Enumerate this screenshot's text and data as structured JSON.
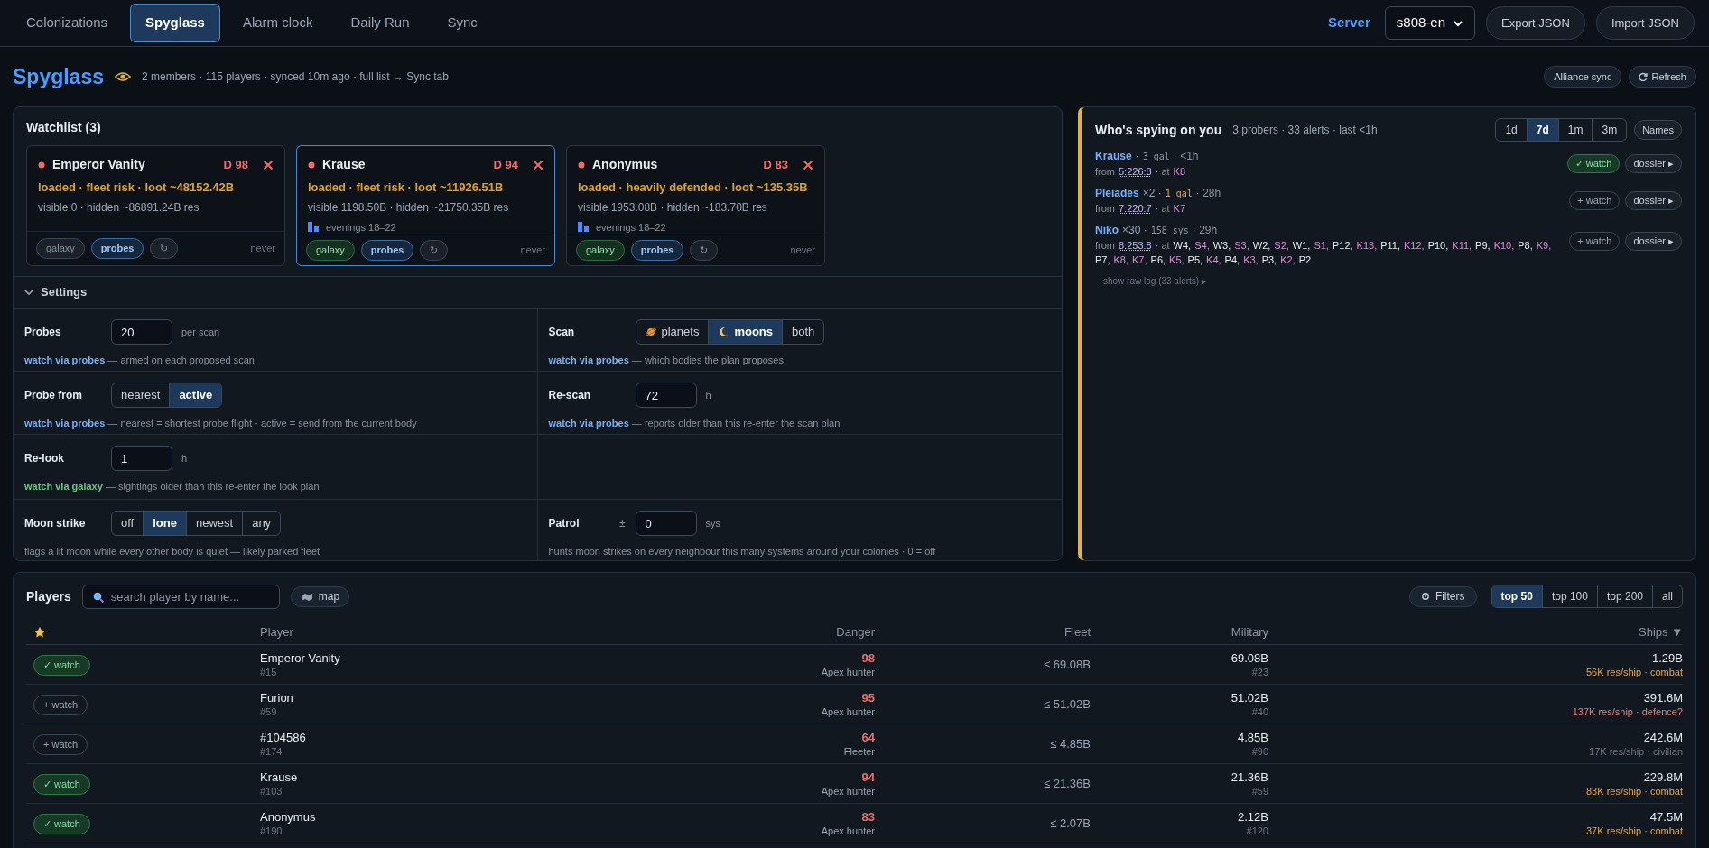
{
  "nav": {
    "tabs": [
      {
        "label": "Colonizations",
        "selected": false
      },
      {
        "label": "Spyglass",
        "selected": true
      },
      {
        "label": "Alarm clock",
        "selected": false
      },
      {
        "label": "Daily Run",
        "selected": false
      },
      {
        "label": "Sync",
        "selected": false
      }
    ],
    "server_label": "Server",
    "server_value": "s808-en",
    "buttons": [
      "Export JSON",
      "Import JSON"
    ]
  },
  "header": {
    "title": "Spyglass",
    "subtitle": "2 members · 115 players · synced 10m ago · full list → Sync tab",
    "buttons": [
      {
        "label": "Alliance sync",
        "kind": "plain"
      },
      {
        "label": "Refresh",
        "kind": "refresh"
      }
    ]
  },
  "watchlist": {
    "title": "Watchlist (3)",
    "cards": [
      {
        "name": "Emperor Vanity",
        "selected": false,
        "danger": "D 98",
        "status": "loaded · fleet risk · loot ~48152.42B",
        "resources": "visible 0 · hidden ~86891.24B res",
        "tags": [
          {
            "label": "galaxy",
            "kind": "galaxy",
            "on": false
          },
          {
            "label": "probes",
            "kind": "probes",
            "on": true
          }
        ],
        "refresh": "↻",
        "last": "never"
      },
      {
        "name": "Krause",
        "selected": true,
        "danger": "D 94",
        "status": "loaded · fleet risk · loot ~11926.51B",
        "resources": "visible 1198.50B · hidden ~21750.35B res",
        "activity": "evenings 18–22",
        "tags": [
          {
            "label": "galaxy",
            "kind": "galaxy",
            "on": true
          },
          {
            "label": "probes",
            "kind": "probes",
            "on": true
          }
        ],
        "refresh": "↻",
        "last": "never"
      },
      {
        "name": "Anonymus",
        "selected": false,
        "danger": "D 83",
        "status": "loaded · heavily defended · loot ~135.35B",
        "resources": "visible 1953.08B · hidden ~183.70B res",
        "activity": "evenings 18–22",
        "tags": [
          {
            "label": "galaxy",
            "kind": "galaxy",
            "on": true
          },
          {
            "label": "probes",
            "kind": "probes",
            "on": true
          }
        ],
        "refresh": "↻",
        "last": "never"
      }
    ]
  },
  "settings": {
    "title": "Settings",
    "expanded": true,
    "rows": [
      [
        {
          "label": "Probes",
          "kind": "field",
          "value": "20",
          "unit": "per scan",
          "lead": {
            "text": "watch via probes",
            "kind": "probes"
          },
          "hint": "— armed on each proposed scan"
        },
        {
          "label": "Scan",
          "kind": "segmented",
          "options": [
            {
              "label": "planets",
              "kind": "planet",
              "selected": false
            },
            {
              "label": "moons",
              "kind": "moon",
              "selected": true
            },
            {
              "label": "both",
              "selected": false
            }
          ],
          "lead": {
            "text": "watch via probes",
            "kind": "probes"
          },
          "hint": "— which bodies the plan proposes"
        }
      ],
      [
        {
          "label": "Probe from",
          "kind": "segmented",
          "options": [
            {
              "label": "nearest",
              "selected": false
            },
            {
              "label": "active",
              "selected": true
            }
          ],
          "lead": {
            "text": "watch via probes",
            "kind": "probes"
          },
          "hint": "— nearest = shortest probe flight · active = send from the current body"
        },
        {
          "label": "Re-scan",
          "kind": "field",
          "value": "72",
          "unit": "h",
          "lead": {
            "text": "watch via probes",
            "kind": "probes"
          },
          "hint": "— reports older than this re-enter the scan plan"
        }
      ],
      [
        {
          "label": "Re-look",
          "kind": "field",
          "value": "1",
          "unit": "h",
          "lead": {
            "text": "watch via galaxy",
            "kind": "galaxy"
          },
          "hint": "— sightings older than this re-enter the look plan"
        }
      ],
      [
        {
          "label": "Moon strike",
          "kind": "segmented",
          "options": [
            {
              "label": "off",
              "selected": false
            },
            {
              "label": "lone",
              "selected": true
            },
            {
              "label": "newest",
              "selected": false
            },
            {
              "label": "any",
              "selected": false
            }
          ],
          "hint": "flags a lit moon while every other body is quiet — likely parked fleet"
        },
        {
          "label": "Patrol",
          "kind": "field",
          "prefix": "±",
          "value": "0",
          "unit": "sys",
          "hint": "hunts moon strikes on every neighbour this many systems around your colonies · 0 = off"
        }
      ]
    ]
  },
  "spying": {
    "title": "Who's spying on you",
    "summary": "3 probers · 33 alerts · last <1h",
    "ranges": [
      {
        "label": "1d",
        "selected": false
      },
      {
        "label": "7d",
        "selected": true
      },
      {
        "label": "1m",
        "selected": false
      },
      {
        "label": "3m",
        "selected": false
      }
    ],
    "names_button": "Names",
    "probers": [
      {
        "line": [
          {
            "text": "Krause",
            "kind": "name"
          },
          {
            "text": "·",
            "kind": "sep"
          },
          {
            "text": "3 gal",
            "kind": "scope"
          },
          {
            "text": "· <1h",
            "kind": "sep"
          }
        ],
        "origin": [
          {
            "text": "from",
            "kind": "sep"
          },
          {
            "text": "5:226:8",
            "kind": "coords"
          },
          {
            "text": "· at",
            "kind": "sep"
          },
          {
            "text": "K8",
            "kind": "moon"
          }
        ],
        "watched": true,
        "watch_label": "✓ watch",
        "dossier": "dossier ▸"
      },
      {
        "line": [
          {
            "text": "Pleiades",
            "kind": "name"
          },
          {
            "text": "×2 ·",
            "kind": "count"
          },
          {
            "text": "1 gal",
            "kind": "scope_hot"
          },
          {
            "text": "· 28h",
            "kind": "sep"
          }
        ],
        "origin": [
          {
            "text": "from",
            "kind": "sep"
          },
          {
            "text": "7:220:7",
            "kind": "coords"
          },
          {
            "text": "· at",
            "kind": "sep"
          },
          {
            "text": "K7",
            "kind": "moon"
          }
        ],
        "watched": false,
        "watch_label": "+ watch",
        "dossier": "dossier ▸"
      },
      {
        "line": [
          {
            "text": "Niko",
            "kind": "name"
          },
          {
            "text": "×30 ·",
            "kind": "count"
          },
          {
            "text": "158 sys",
            "kind": "scope"
          },
          {
            "text": "· 29h",
            "kind": "sep"
          }
        ],
        "origin": [
          {
            "text": "from",
            "kind": "sep"
          },
          {
            "text": "8:253:8",
            "kind": "coords"
          },
          {
            "text": "· at",
            "kind": "sep"
          },
          {
            "text": "W4,",
            "kind": "planet"
          },
          {
            "text": "S4,",
            "kind": "moon"
          },
          {
            "text": "W3,",
            "kind": "planet"
          },
          {
            "text": "S3,",
            "kind": "moon"
          },
          {
            "text": "W2,",
            "kind": "planet"
          },
          {
            "text": "S2,",
            "kind": "moon"
          },
          {
            "text": "W1,",
            "kind": "planet"
          },
          {
            "text": "S1,",
            "kind": "moon"
          },
          {
            "text": "P12,",
            "kind": "planet"
          },
          {
            "text": "K13,",
            "kind": "moon"
          },
          {
            "text": "P11,",
            "kind": "planet"
          },
          {
            "text": "K12,",
            "kind": "moon"
          },
          {
            "text": "P10,",
            "kind": "planet"
          },
          {
            "text": "K11,",
            "kind": "moon"
          },
          {
            "text": "P9,",
            "kind": "planet"
          },
          {
            "text": "K10,",
            "kind": "moon"
          },
          {
            "text": "P8,",
            "kind": "planet"
          },
          {
            "text": "K9,",
            "kind": "moon"
          },
          {
            "text": "P7,",
            "kind": "planet"
          },
          {
            "text": "K8,",
            "kind": "moon"
          },
          {
            "text": "K7,",
            "kind": "moon"
          },
          {
            "text": "P6,",
            "kind": "planet"
          },
          {
            "text": "K5,",
            "kind": "moon"
          },
          {
            "text": "P5,",
            "kind": "planet"
          },
          {
            "text": "K4,",
            "kind": "moon"
          },
          {
            "text": "P4,",
            "kind": "planet"
          },
          {
            "text": "K3,",
            "kind": "moon"
          },
          {
            "text": "P3,",
            "kind": "planet"
          },
          {
            "text": "K2,",
            "kind": "moon"
          },
          {
            "text": "P2",
            "kind": "planet"
          }
        ],
        "watched": false,
        "watch_label": "+ watch",
        "dossier": "dossier ▸"
      }
    ],
    "raw_log": "show raw log (33 alerts) ▸"
  },
  "players": {
    "title": "Players",
    "search_placeholder": "search player by name...",
    "map_button": "map",
    "filters_button": "Filters",
    "ranges": [
      {
        "label": "top 50",
        "selected": true
      },
      {
        "label": "top 100",
        "selected": false
      },
      {
        "label": "top 200",
        "selected": false
      },
      {
        "label": "all",
        "selected": false
      }
    ],
    "columns": [
      "Player",
      "Danger",
      "Fleet",
      "Military",
      "Ships ▼"
    ],
    "rows": [
      {
        "watched": true,
        "watch_label": "✓ watch",
        "name": "Emperor Vanity",
        "rank": "#15",
        "danger": "98",
        "danger_label": "Apex hunter",
        "fleet": "≤ 69.08B",
        "military": "69.08B",
        "military_rank": "#23",
        "ships": "1.29B",
        "ships_note": {
          "text": "56K res/ship · combat",
          "kind": "combat"
        }
      },
      {
        "watched": false,
        "watch_label": "+ watch",
        "name": "Furion",
        "rank": "#59",
        "danger": "95",
        "danger_label": "Apex hunter",
        "fleet": "≤ 51.02B",
        "military": "51.02B",
        "military_rank": "#40",
        "ships": "391.6M",
        "ships_note": {
          "text": "137K res/ship · defence?",
          "kind": "defence"
        }
      },
      {
        "watched": false,
        "watch_label": "+ watch",
        "name": "#104586",
        "rank": "#174",
        "danger": "64",
        "danger_label": "Fleeter",
        "fleet": "≤ 4.85B",
        "military": "4.85B",
        "military_rank": "#90",
        "ships": "242.6M",
        "ships_note": {
          "text": "17K res/ship · civilian",
          "kind": "civilian"
        }
      },
      {
        "watched": true,
        "watch_label": "✓ watch",
        "name": "Krause",
        "rank": "#103",
        "danger": "94",
        "danger_label": "Apex hunter",
        "fleet": "≤ 21.36B",
        "military": "21.36B",
        "military_rank": "#59",
        "ships": "229.8M",
        "ships_note": {
          "text": "83K res/ship · combat",
          "kind": "combat"
        }
      },
      {
        "watched": true,
        "watch_label": "✓ watch",
        "name": "Anonymus",
        "rank": "#190",
        "danger": "83",
        "danger_label": "Apex hunter",
        "fleet": "≤ 2.07B",
        "military": "2.12B",
        "military_rank": "#120",
        "ships": "47.5M",
        "ships_note": {
          "text": "37K res/ship · combat",
          "kind": "combat"
        }
      }
    ]
  }
}
